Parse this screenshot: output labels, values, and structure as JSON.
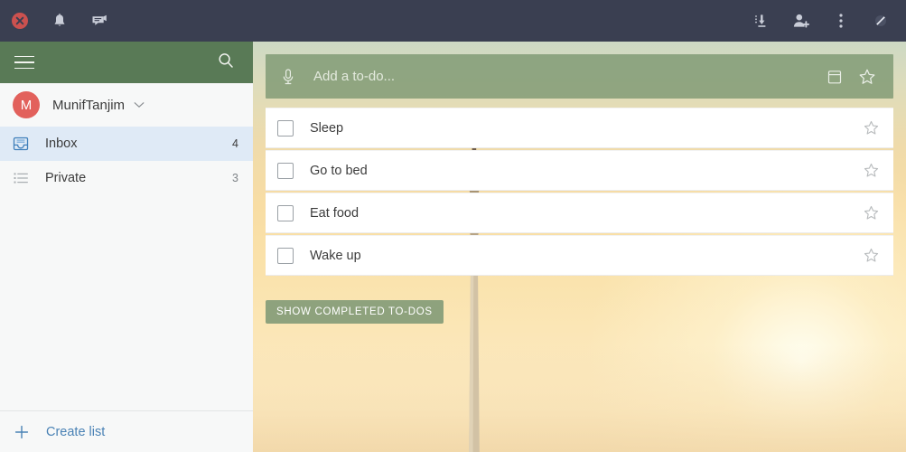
{
  "titlebar": {
    "left_buttons": [
      {
        "name": "close-icon",
        "label": "Close"
      },
      {
        "name": "bell-icon",
        "label": "Notifications"
      },
      {
        "name": "comment-icon",
        "label": "Comments"
      }
    ],
    "right_buttons": [
      {
        "name": "import-icon",
        "label": "Import"
      },
      {
        "name": "add-user-icon",
        "label": "Add user"
      },
      {
        "name": "more-options-icon",
        "label": "More options"
      },
      {
        "name": "disabled-icon",
        "label": "Disabled"
      }
    ]
  },
  "sidebar": {
    "menu_label": "Menu",
    "search_label": "Search",
    "user": {
      "initial": "M",
      "name": "MunifTanjim",
      "avatar_color": "#e2615c"
    },
    "items": [
      {
        "label": "Inbox",
        "count": "4",
        "icon": "inbox-icon",
        "active": true
      },
      {
        "label": "Private",
        "count": "3",
        "icon": "list-icon",
        "active": false
      }
    ],
    "create_list_label": "Create list"
  },
  "main": {
    "add_todo": {
      "placeholder": "Add a to-do...",
      "value": "",
      "mic_icon": "microphone-icon",
      "calendar_icon": "calendar-icon",
      "star_icon": "star-icon"
    },
    "todos": [
      {
        "label": "Sleep",
        "checked": false,
        "starred": false
      },
      {
        "label": "Go to bed",
        "checked": false,
        "starred": false
      },
      {
        "label": "Eat food",
        "checked": false,
        "starred": false
      },
      {
        "label": "Wake up",
        "checked": false,
        "starred": false
      }
    ],
    "show_completed_label": "SHOW COMPLETED TO-DOS"
  },
  "colors": {
    "titlebar": "#3a3f51",
    "sidebar_header_green": "#597a56",
    "sidebar_bg": "#f7f8f8",
    "active_item": "#dfeaf6",
    "accent_blue": "#4a82b5",
    "close_red": "#e05a58",
    "addbar_green": "rgba(122,150,112,0.78)"
  }
}
